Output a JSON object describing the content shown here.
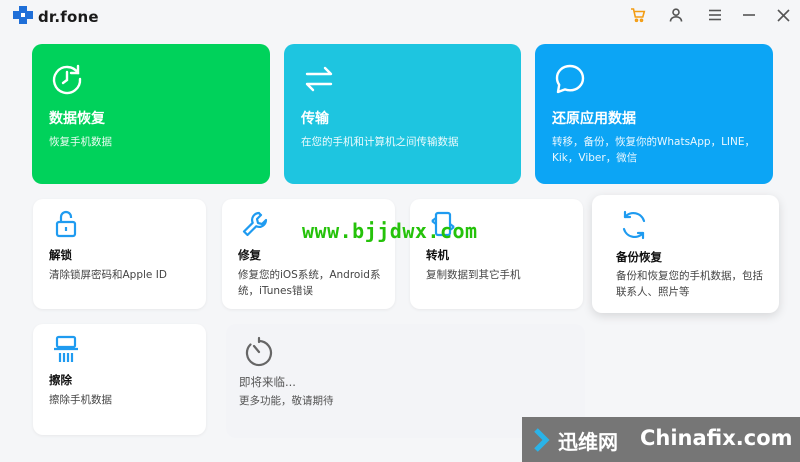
{
  "app": {
    "brand": "dr.fone",
    "logo_icon": "plus-cross-logo-icon",
    "accent": "#1f6fd8"
  },
  "window_controls": [
    {
      "name": "cart-button",
      "icon": "cart-icon",
      "color": "#f39c12"
    },
    {
      "name": "account-button",
      "icon": "user-icon"
    },
    {
      "name": "menu-button",
      "icon": "hamburger-menu-icon"
    },
    {
      "name": "minimize-button",
      "icon": "minimize-icon"
    },
    {
      "name": "close-button",
      "icon": "close-icon"
    }
  ],
  "feature_cards": {
    "data_recovery": {
      "title": "数据恢复",
      "desc": "恢复手机数据",
      "color": "#00d25b",
      "icon": "clock-restore-icon"
    },
    "transfer": {
      "title": "传输",
      "desc": "在您的手机和计算机之间传输数据",
      "color": "#1ec5e0",
      "icon": "transfer-arrows-icon"
    },
    "app_restore": {
      "title": "还原应用数据",
      "desc": "转移，备份，恢复你的WhatsApp，LINE，Kik，Viber，微信",
      "color": "#0ca5f5",
      "icon": "chat-bubble-icon"
    },
    "unlock": {
      "title": "解锁",
      "desc": "清除锁屏密码和Apple ID",
      "icon": "unlock-icon"
    },
    "repair": {
      "title": "修复",
      "desc": "修复您的iOS系统，Android系统，iTunes错误",
      "icon": "wrench-icon"
    },
    "phone_transfer": {
      "title": "转机",
      "desc": "复制数据到其它手机",
      "icon": "phone-switch-icon"
    },
    "backup": {
      "title": "备份恢复",
      "desc": "备份和恢复您的手机数据，包括联系人、照片等",
      "icon": "sync-icon"
    },
    "erase": {
      "title": "擦除",
      "desc": "擦除手机数据",
      "icon": "shredder-icon"
    },
    "coming_soon": {
      "title": "即将来临...",
      "desc": "更多功能，敬请期待",
      "icon": "timer-icon"
    }
  },
  "watermarks": {
    "site_url": "www.bjjdwx.com",
    "banner_cn": "迅维网",
    "banner_en": "Chinafix.com"
  }
}
